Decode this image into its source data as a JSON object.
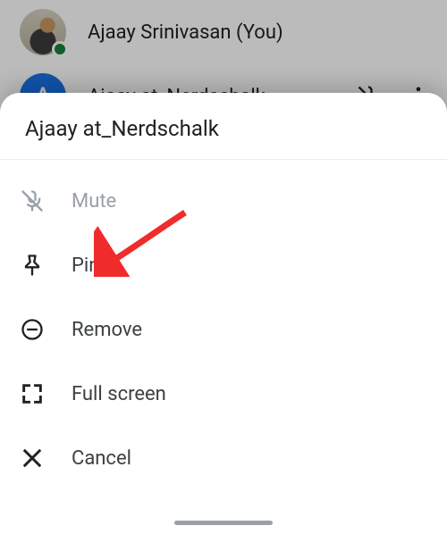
{
  "participants": [
    {
      "name": "Ajaay Srinivasan (You)",
      "initial": "",
      "presence": true
    },
    {
      "name": "Ajaay at_Nerdschalk",
      "initial": "A",
      "presence": false
    }
  ],
  "sheet": {
    "title": "Ajaay at_Nerdschalk",
    "items": {
      "mute": "Mute",
      "pin": "Pin",
      "remove": "Remove",
      "fullscreen": "Full screen",
      "cancel": "Cancel"
    }
  }
}
